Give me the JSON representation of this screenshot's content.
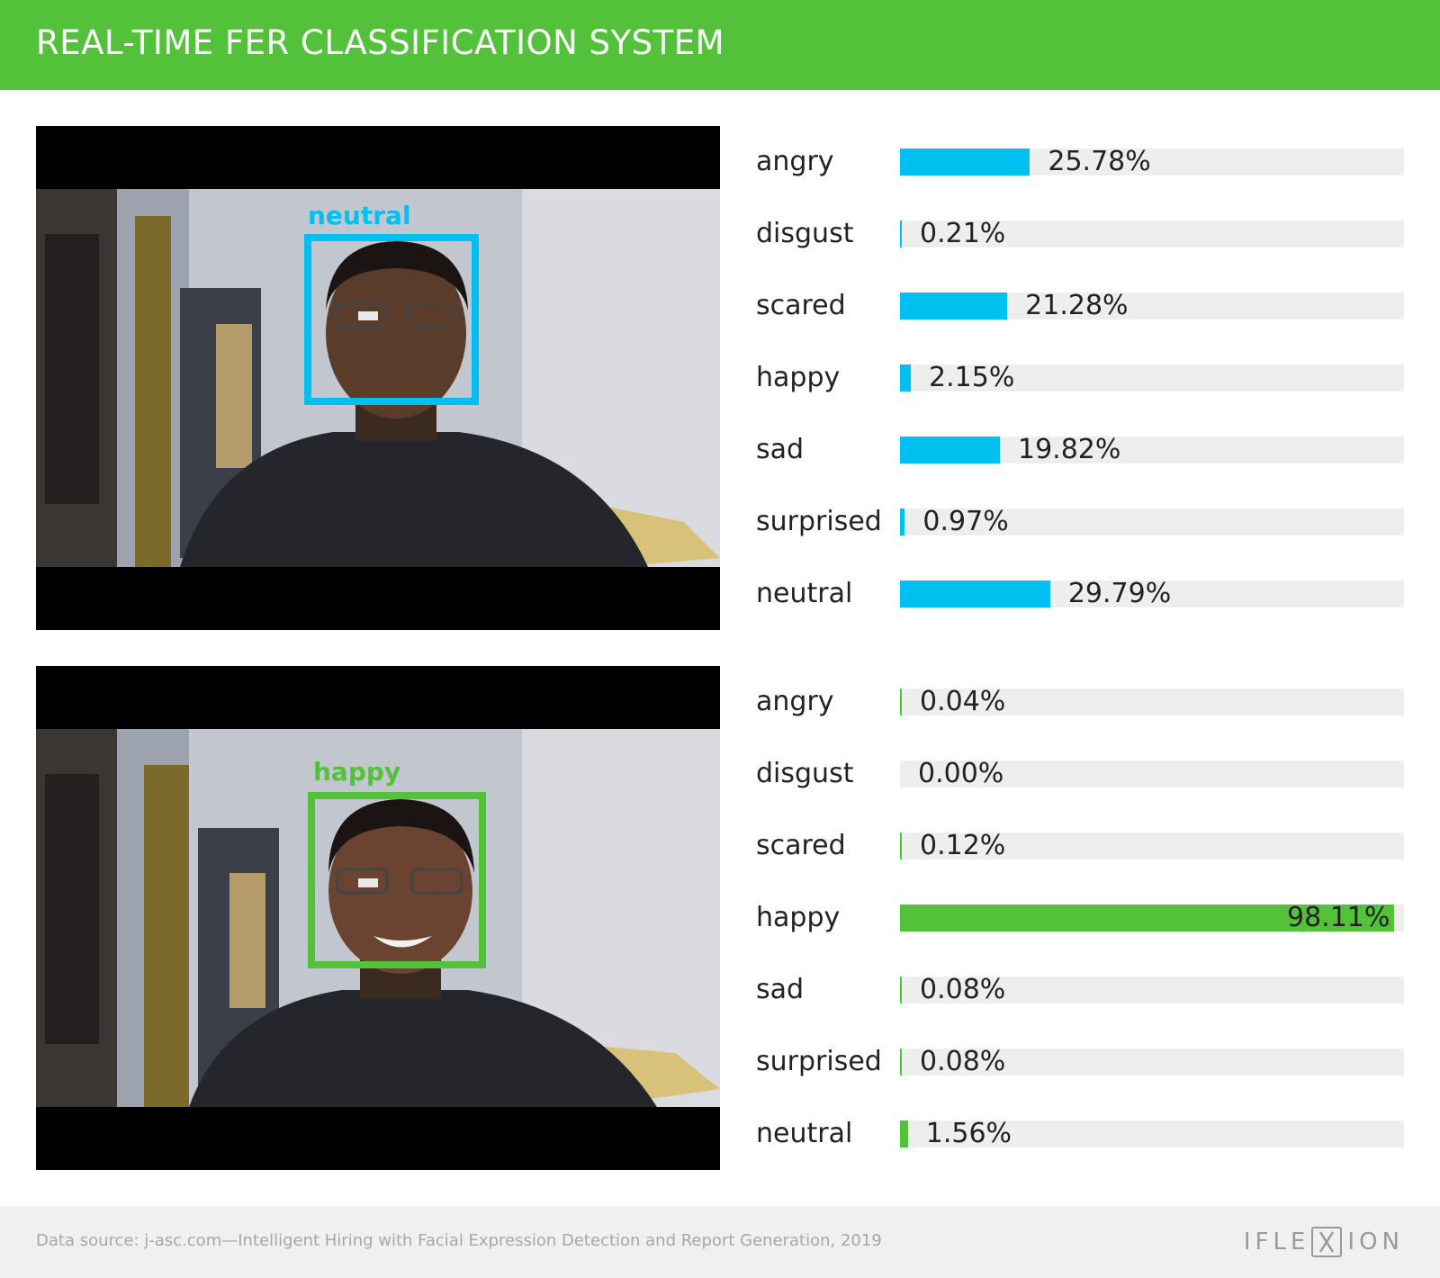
{
  "header": {
    "title": "REAL-TIME FER CLASSIFICATION SYSTEM"
  },
  "colors": {
    "brand_green": "#53c23a",
    "neutral_blue": "#00c0f2",
    "happy_green": "#53c23a",
    "track": "#eeeeee"
  },
  "panels": [
    {
      "detected_label": "neutral",
      "box_color": "#00c0f2"
    },
    {
      "detected_label": "happy",
      "box_color": "#53c23a"
    }
  ],
  "chart_data": [
    {
      "type": "bar",
      "orientation": "horizontal",
      "categories": [
        "angry",
        "disgust",
        "scared",
        "happy",
        "sad",
        "surprised",
        "neutral"
      ],
      "values": [
        25.78,
        0.21,
        21.28,
        2.15,
        19.82,
        0.97,
        29.79
      ],
      "value_labels": [
        "25.78%",
        "0.21%",
        "21.28%",
        "2.15%",
        "19.82%",
        "0.97%",
        "29.79%"
      ],
      "color": "#00c0f2",
      "xlim": [
        0,
        100
      ]
    },
    {
      "type": "bar",
      "orientation": "horizontal",
      "categories": [
        "angry",
        "disgust",
        "scared",
        "happy",
        "sad",
        "surprised",
        "neutral"
      ],
      "values": [
        0.04,
        0.0,
        0.12,
        98.11,
        0.08,
        0.08,
        1.56
      ],
      "value_labels": [
        "0.04%",
        "0.00%",
        "0.12%",
        "98.11%",
        "0.08%",
        "0.08%",
        "1.56%"
      ],
      "color": "#53c23a",
      "xlim": [
        0,
        100
      ]
    }
  ],
  "footer": {
    "source": "Data source: j-asc.com—Intelligent Hiring with Facial Expression Detection and Report Generation, 2019",
    "logo_left": "IFLE",
    "logo_right": "ION"
  },
  "icons": {
    "logo_mark": "x-bracket-icon",
    "webcam_scene": "webcam-frame-icon"
  }
}
